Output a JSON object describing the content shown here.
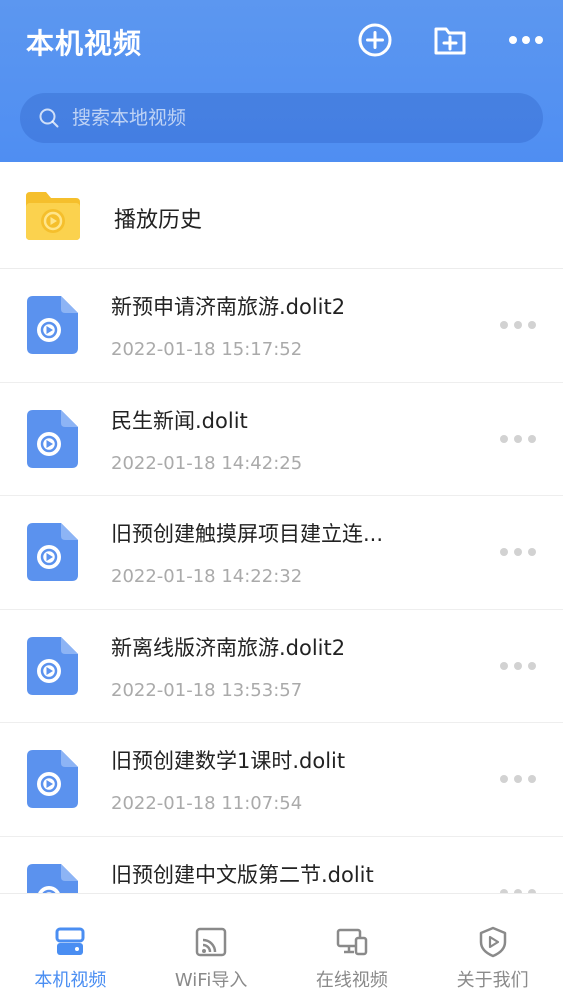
{
  "header": {
    "title": "本机视频",
    "icons": {
      "add": "add-circle-icon",
      "new_folder": "folder-plus-icon",
      "more": "more-horizontal-icon"
    }
  },
  "search": {
    "placeholder": "搜索本地视频",
    "icon": "search-icon"
  },
  "history": {
    "label": "播放历史",
    "icon": "folder-video-icon"
  },
  "videos": [
    {
      "name": "新预申请济南旅游.dolit2",
      "time": "2022-01-18 15:17:52"
    },
    {
      "name": "民生新闻.dolit",
      "time": "2022-01-18 14:42:25"
    },
    {
      "name": "旧预创建触摸屏项目建立连...",
      "time": "2022-01-18 14:22:32"
    },
    {
      "name": "新离线版济南旅游.dolit2",
      "time": "2022-01-18 13:53:57"
    },
    {
      "name": "旧预创建数学1课时.dolit",
      "time": "2022-01-18 11:07:54"
    },
    {
      "name": "旧预创建中文版第二节.dolit",
      "time": ""
    }
  ],
  "nav": [
    {
      "label": "本机视频",
      "icon": "local-storage-icon",
      "active": true
    },
    {
      "label": "WiFi导入",
      "icon": "cast-icon",
      "active": false
    },
    {
      "label": "在线视频",
      "icon": "devices-icon",
      "active": false
    },
    {
      "label": "关于我们",
      "icon": "shield-play-icon",
      "active": false
    }
  ],
  "colors": {
    "primary": "#4f8ef2",
    "folder": "#f7c948",
    "file_icon": "#5b92ee",
    "muted": "#aaaaaa"
  }
}
